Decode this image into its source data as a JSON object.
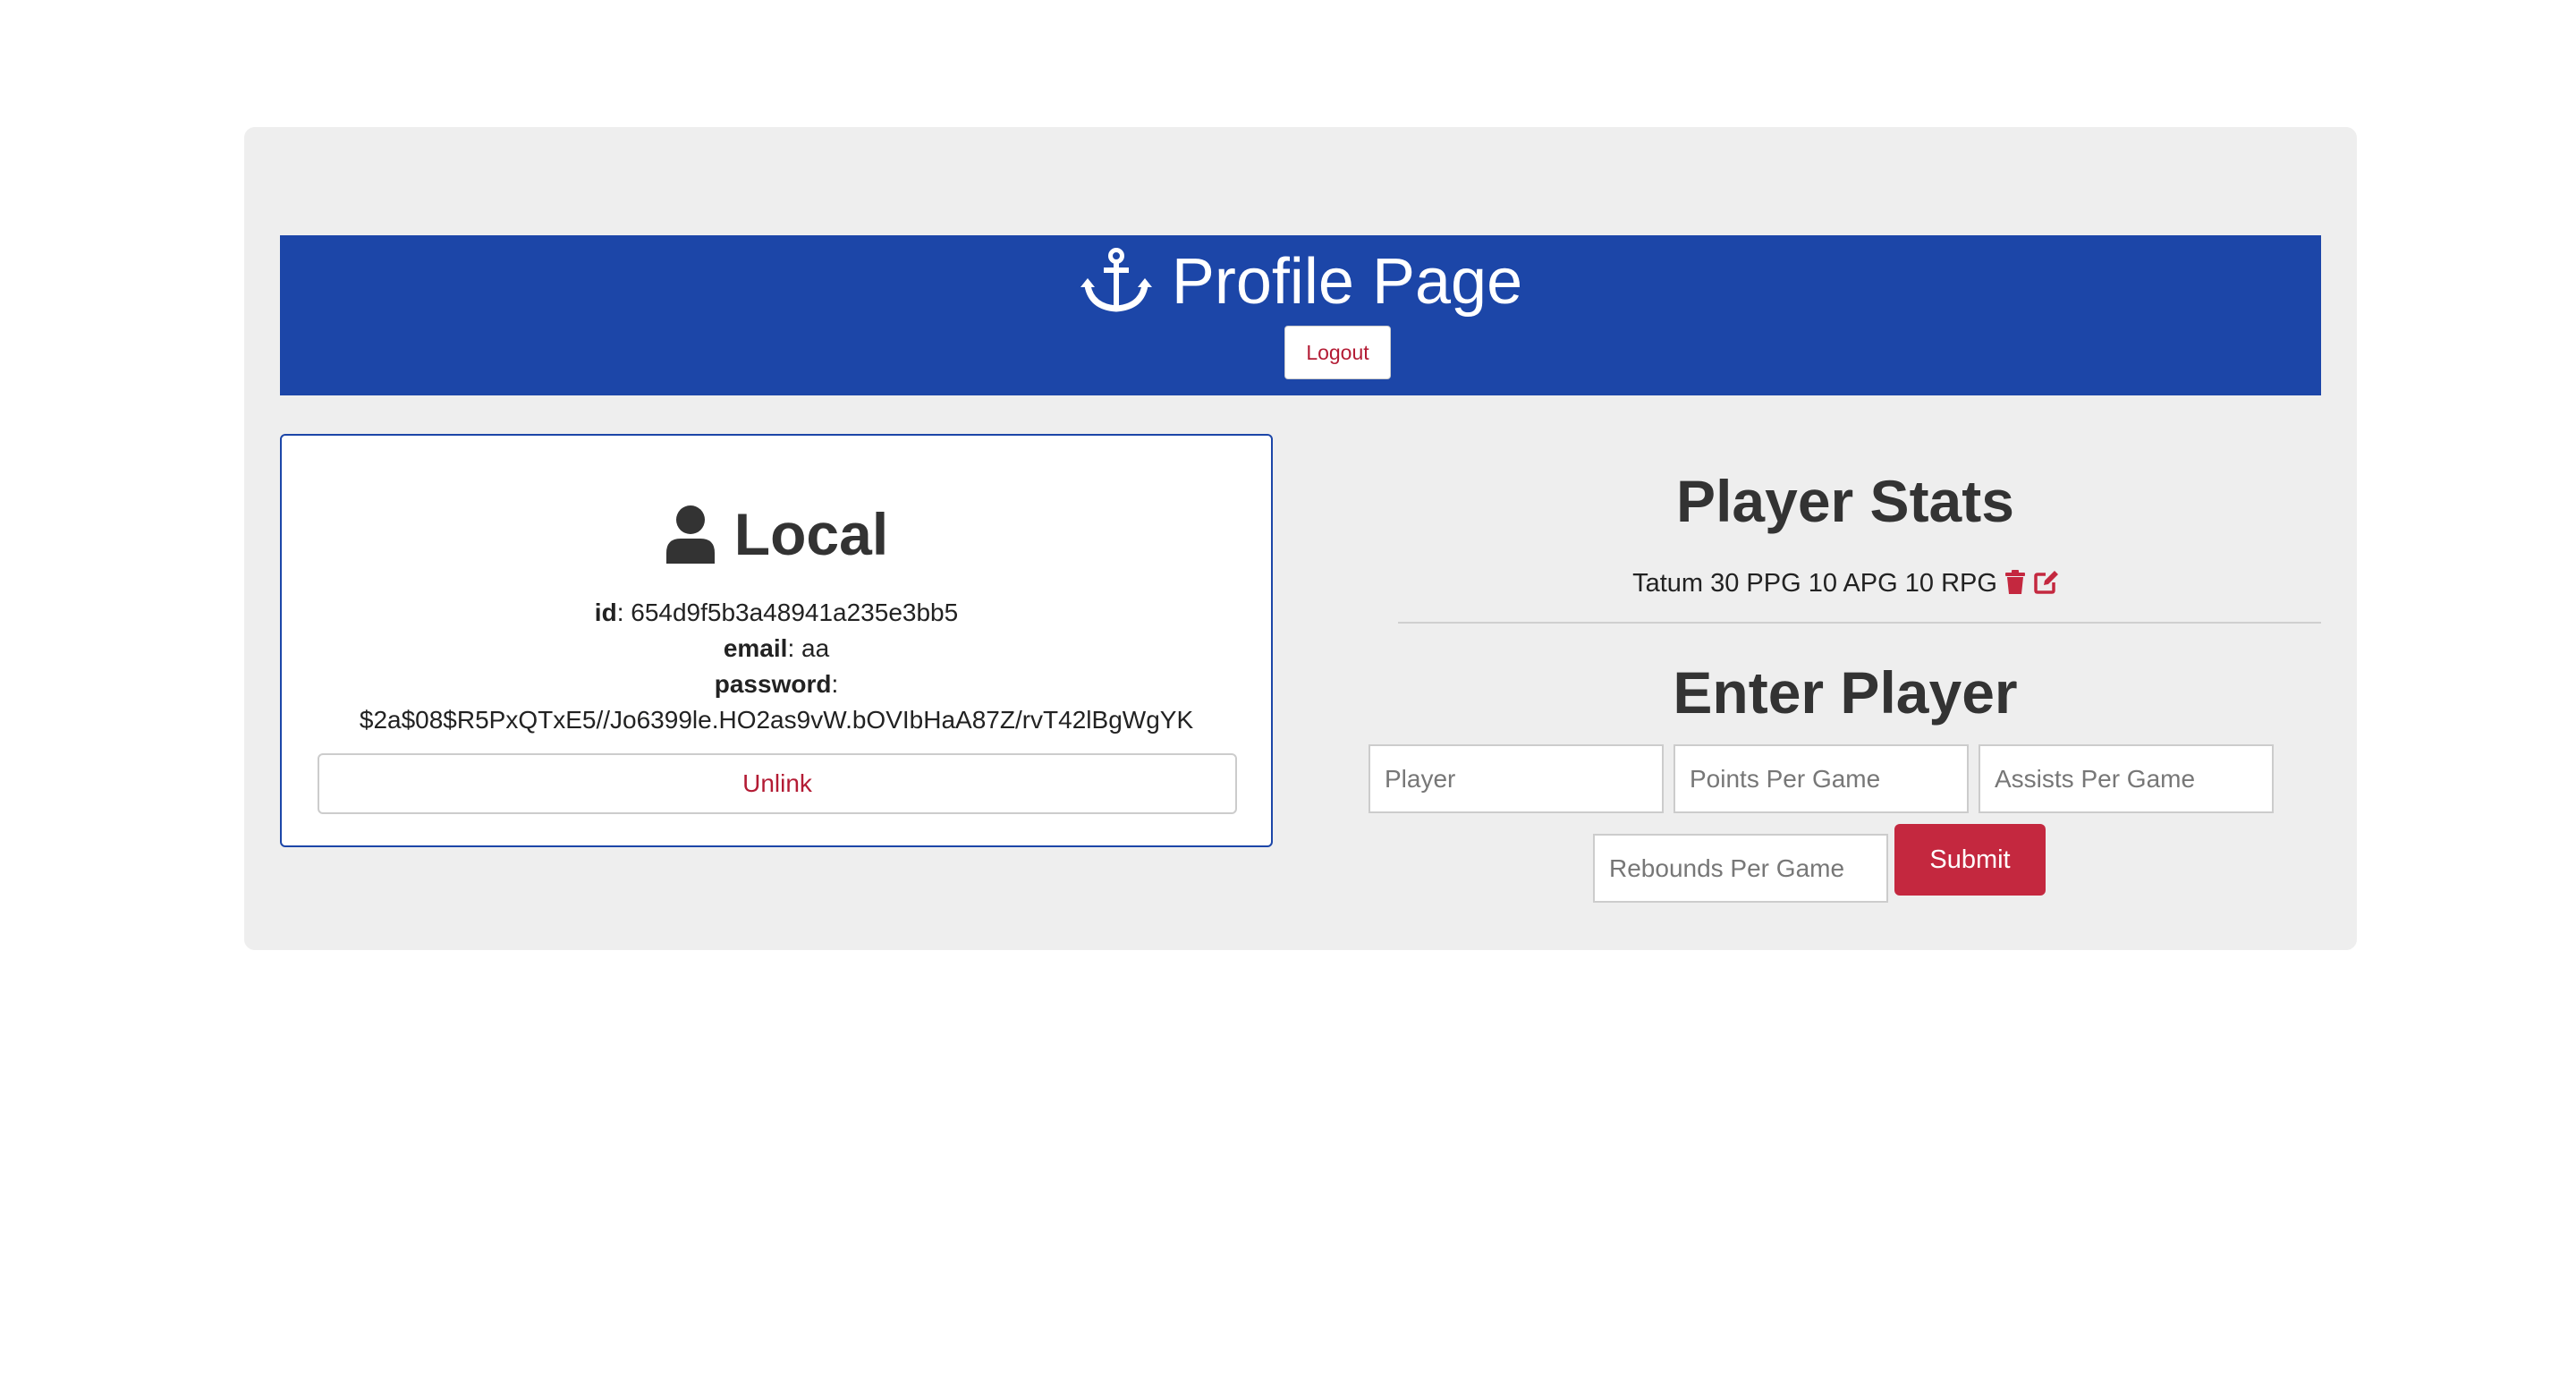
{
  "header": {
    "title": "Profile Page",
    "logout_label": "Logout"
  },
  "local": {
    "title": "Local",
    "id_label": "id",
    "id_value": "654d9f5b3a48941a235e3bb5",
    "email_label": "email",
    "email_value": "aa",
    "password_label": "password",
    "password_value": "$2a$08$R5PxQTxE5//Jo6399le.HO2as9vW.bOVIbHaA87Z/rvT42lBgWgYK",
    "unlink_label": "Unlink"
  },
  "stats": {
    "title": "Player Stats",
    "entries": [
      {
        "text": "Tatum 30 PPG 10 APG 10 RPG"
      }
    ]
  },
  "form": {
    "title": "Enter Player",
    "player_placeholder": "Player",
    "points_placeholder": "Points Per Game",
    "assists_placeholder": "Assists Per Game",
    "rebounds_placeholder": "Rebounds Per Game",
    "submit_label": "Submit"
  },
  "icons": {
    "title_icon": "anchor-icon",
    "local_icon": "user-icon",
    "delete_icon": "trash-icon",
    "edit_icon": "edit-icon"
  },
  "colors": {
    "header_bg": "#1c46a8",
    "accent_red": "#c4283f",
    "panel_bg": "#eeeeee"
  }
}
